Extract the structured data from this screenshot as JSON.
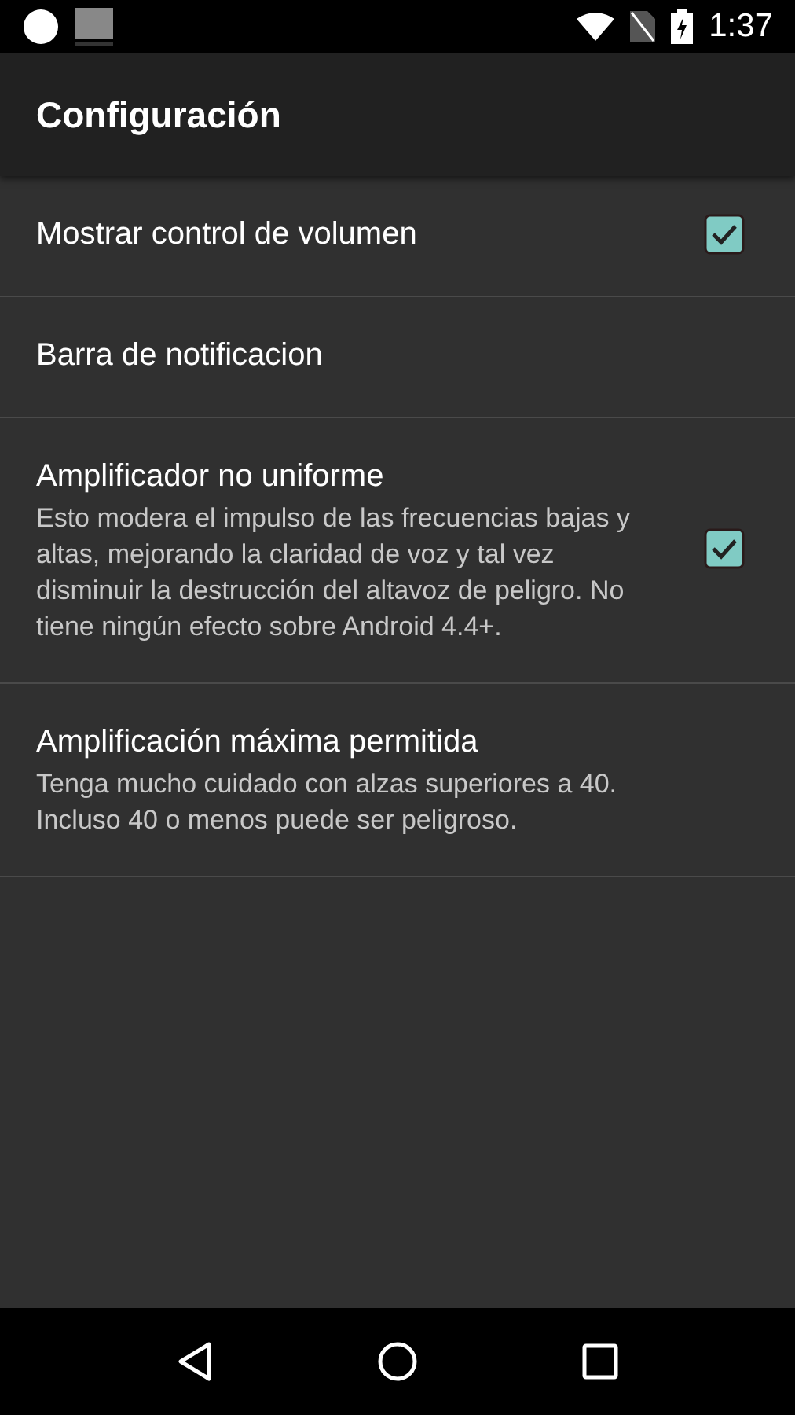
{
  "status_bar": {
    "time": "1:37"
  },
  "app_bar": {
    "title": "Configuración"
  },
  "settings": [
    {
      "kind": "checkbox",
      "title": "Mostrar control de volumen",
      "checked": true
    },
    {
      "kind": "plain",
      "title": "Barra de notificacion"
    },
    {
      "kind": "checkbox",
      "title": "Amplificador no uniforme",
      "summary": "Esto modera el impulso de las frecuencias bajas y altas, mejorando la claridad de voz y tal vez disminuir la destrucción del altavoz de peligro. No tiene ningún efecto sobre Android 4.4+.",
      "checked": true
    },
    {
      "kind": "plain",
      "title": "Amplificación máxima permitida",
      "summary": "Tenga mucho cuidado con alzas superiores a 40. Incluso 40 o menos puede ser peligroso."
    }
  ]
}
